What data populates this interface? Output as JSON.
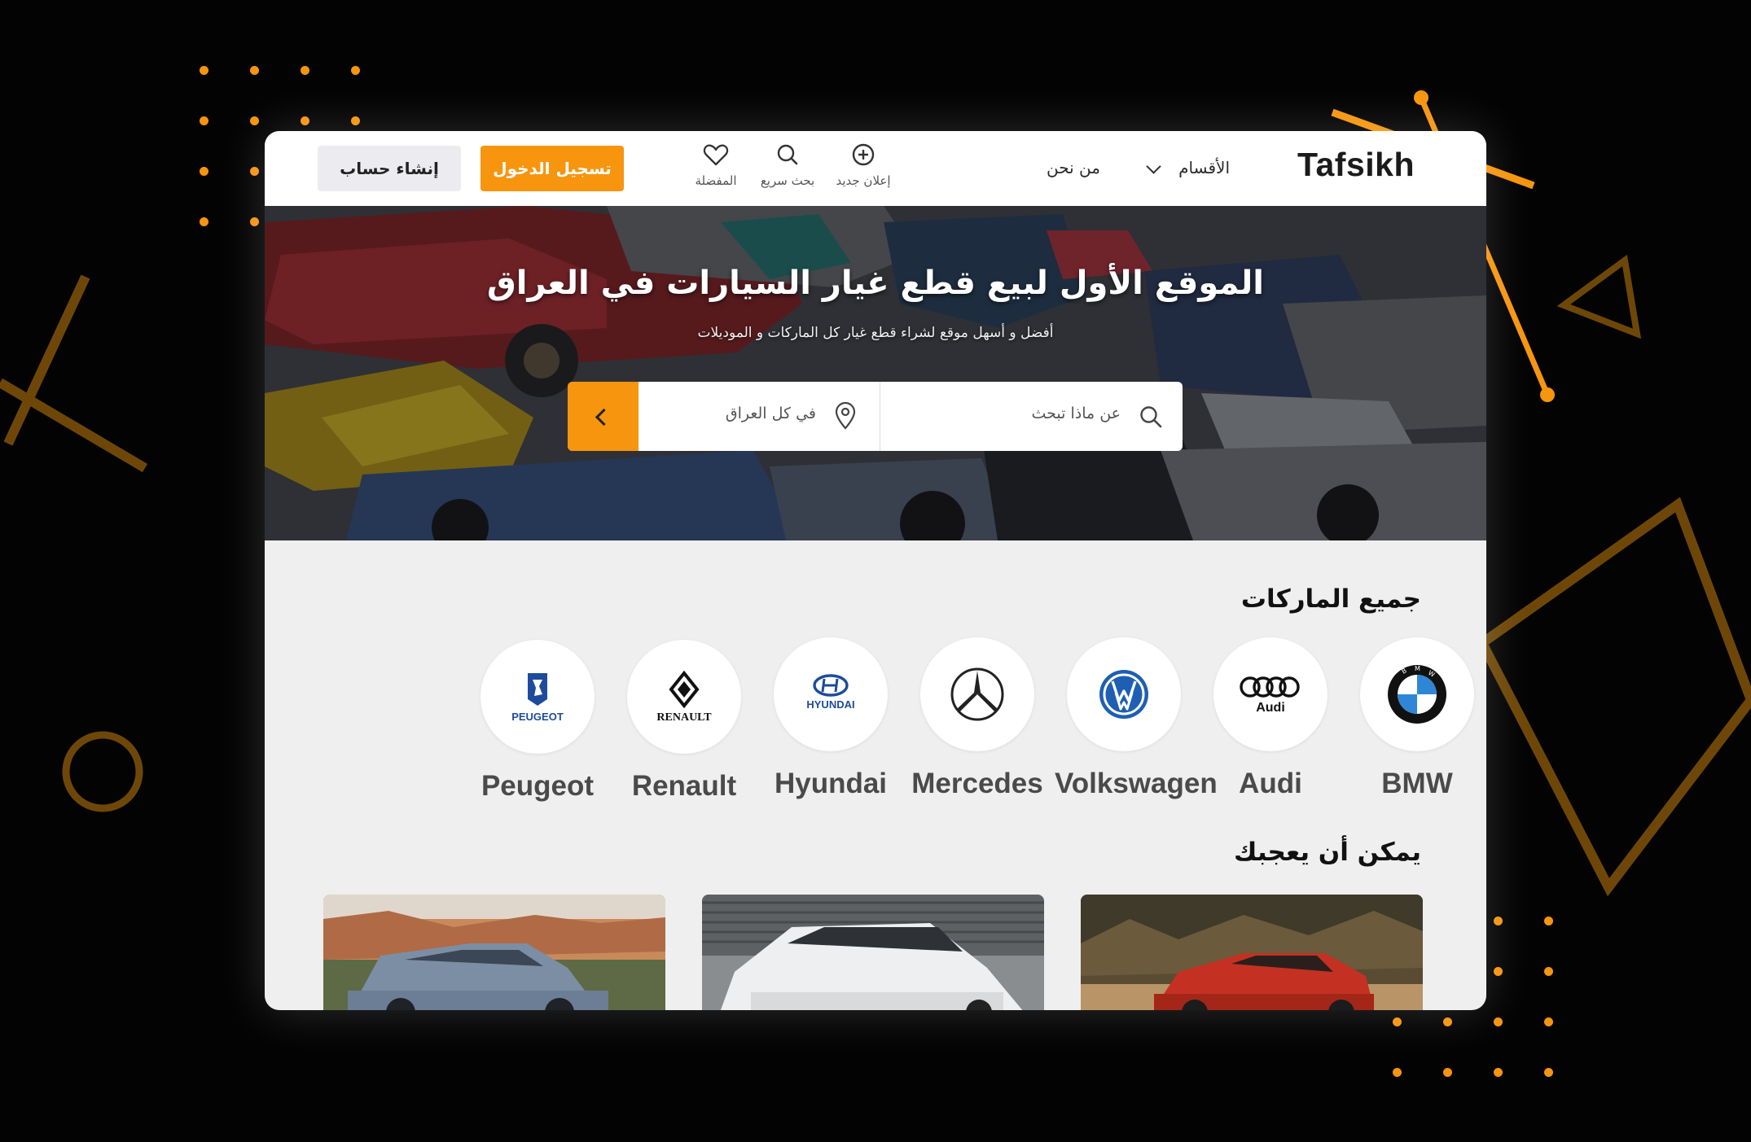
{
  "colors": {
    "accent": "#f7950f",
    "background": "#030303",
    "deco": "#6e4708"
  },
  "header": {
    "logo": "Tafsikh",
    "nav": {
      "categories_label": "الأقسام",
      "about_label": "من نحن"
    },
    "icons": [
      {
        "name": "new-ad",
        "icon": "plus-circle-icon",
        "label": "إعلان جديد"
      },
      {
        "name": "quick-search",
        "icon": "search-icon",
        "label": "بحث سريع"
      },
      {
        "name": "favorites",
        "icon": "heart-icon",
        "label": "المفضلة"
      }
    ],
    "login_label": "تسجيل الدخول",
    "signup_label": "إنشاء حساب"
  },
  "hero": {
    "title": "الموقع الأول لبيع قطع غيار السيارات في العراق",
    "subtitle": "أفضل و أسهل موقع لشراء قطع غيار كل الماركات و الموديلات",
    "search_placeholder": "عن ماذا تبحث",
    "location_placeholder": "في كل العراق"
  },
  "brands": {
    "title": "جميع الماركات",
    "items": [
      {
        "name": "BMW",
        "logo": "bmw-logo"
      },
      {
        "name": "Audi",
        "logo": "audi-logo"
      },
      {
        "name": "Volkswagen",
        "logo": "volkswagen-logo"
      },
      {
        "name": "Mercedes",
        "logo": "mercedes-logo"
      },
      {
        "name": "Hyundai",
        "logo": "hyundai-logo",
        "logo_text": "HYUNDAI"
      },
      {
        "name": "Renault",
        "logo": "renault-logo",
        "logo_text": "RENAULT"
      },
      {
        "name": "Peugeot",
        "logo": "peugeot-logo",
        "logo_text": "PEUGEOT"
      }
    ]
  },
  "recommended": {
    "title": "يمكن أن يعجبك",
    "items": [
      {
        "image": "grey-suv-photo"
      },
      {
        "image": "white-hatchback-photo"
      },
      {
        "image": "red-compact-suv-photo"
      }
    ]
  }
}
